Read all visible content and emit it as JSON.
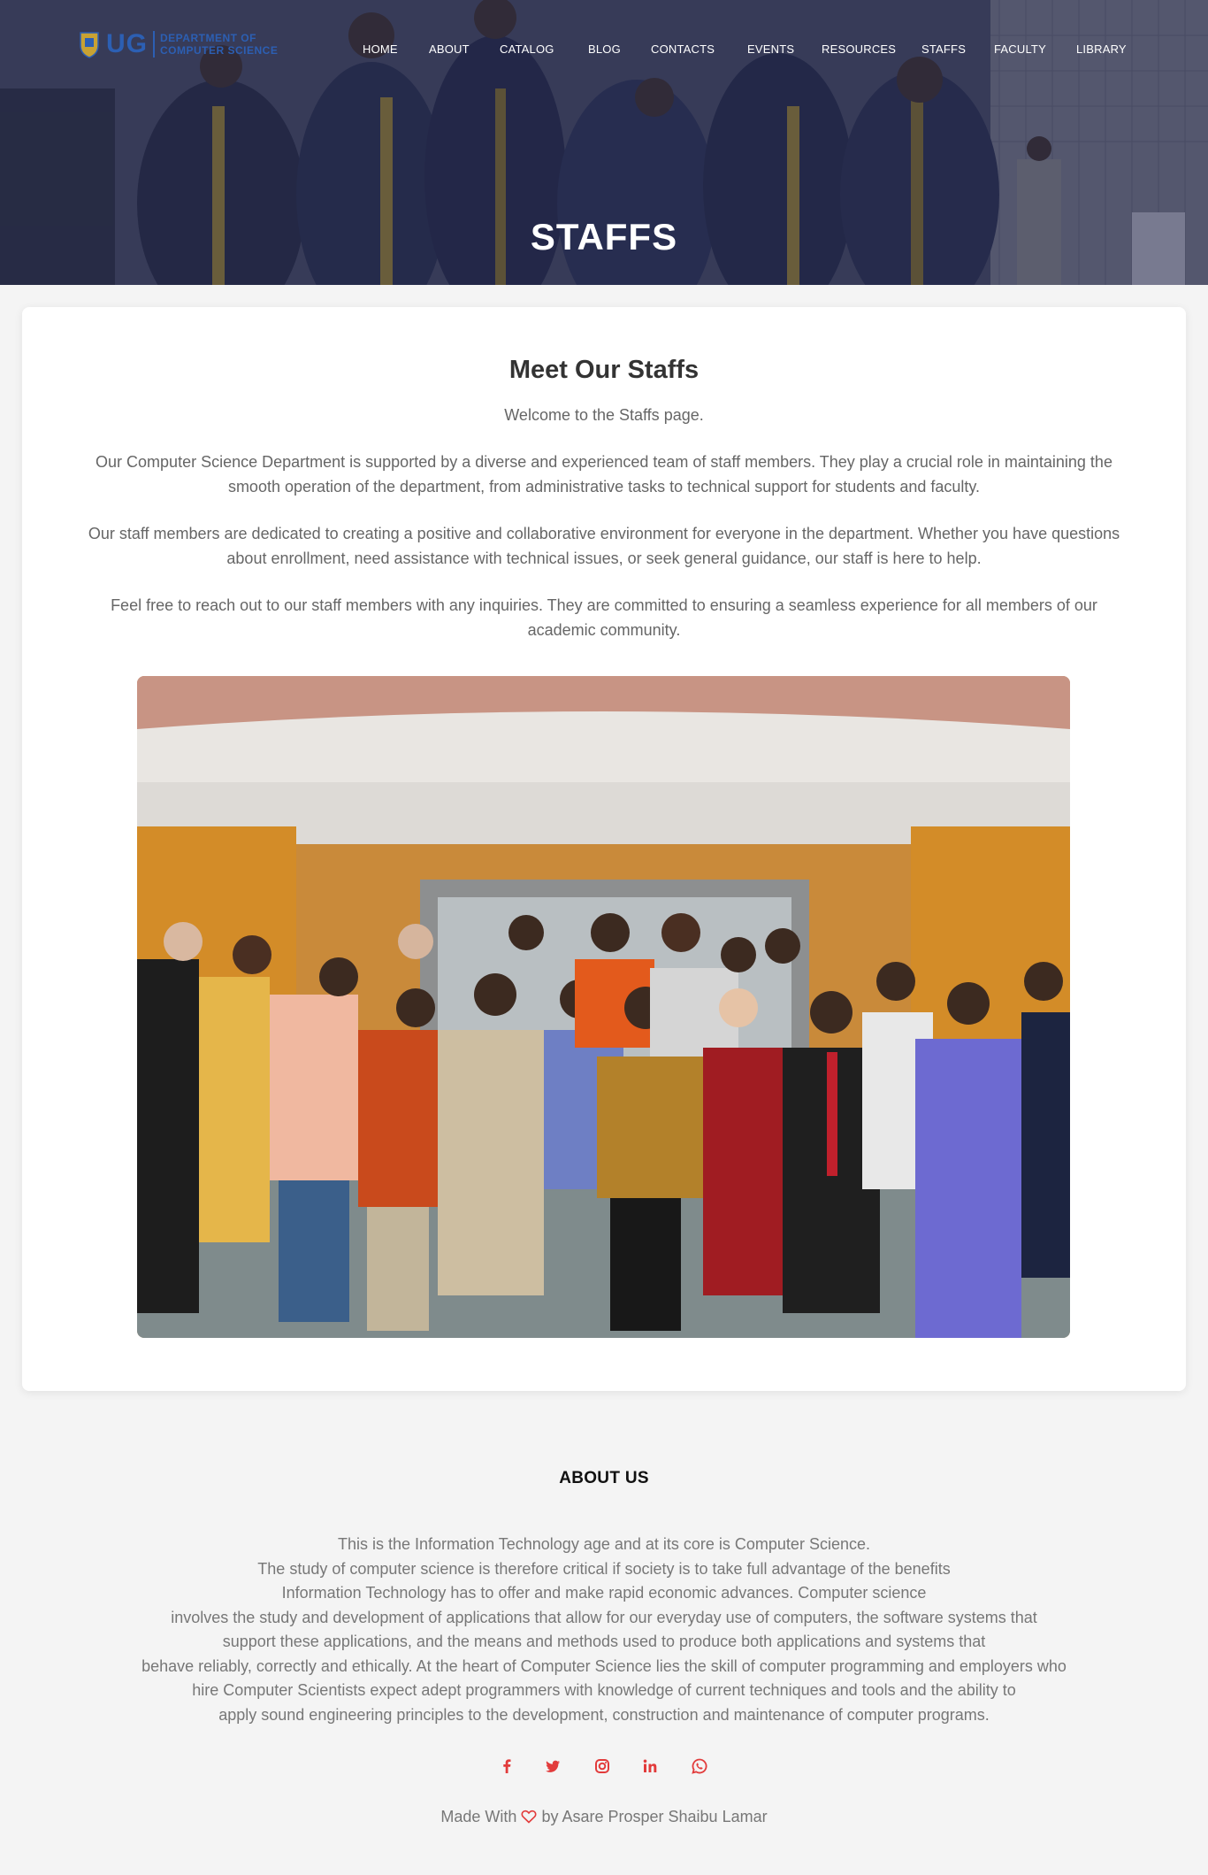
{
  "header": {
    "logo_uni": "UG",
    "logo_dept_line1": "DEPARTMENT OF",
    "logo_dept_line2": "COMPUTER SCIENCE",
    "nav": [
      "HOME",
      "ABOUT",
      "CATALOG",
      "BLOG",
      "CONTACTS",
      "EVENTS",
      "RESOURCES",
      "STAFFS",
      "FACULTY",
      "LIBRARY"
    ],
    "hero_title": "STAFFS"
  },
  "main": {
    "title": "Meet Our Staffs",
    "intro": "Welcome to the Staffs page.",
    "paragraphs": [
      "Our Computer Science Department is supported by a diverse and experienced team of staff members. They play a crucial role in maintaining the smooth operation of the department, from administrative tasks to technical support for students and faculty.",
      "Our staff members are dedicated to creating a positive and collaborative environment for everyone in the department. Whether you have questions about enrollment, need assistance with technical issues, or seek general guidance, our staff is here to help.",
      "Feel free to reach out to our staff members with any inquiries. They are committed to ensuring a seamless experience for all members of our academic community."
    ]
  },
  "footer": {
    "about_title": "ABOUT US",
    "about_lines": [
      "This is the Information Technology age and at its core is Computer Science.",
      "The study of computer science is therefore critical if society is to take full advantage of the benefits",
      "Information Technology has to offer and make rapid economic advances. Computer science",
      "involves the study and development of applications that allow for our everyday use of computers, the software systems that",
      "support these applications, and the means and methods used to produce both applications and systems that",
      "behave reliably, correctly and ethically. At the heart of Computer Science lies the skill of computer programming and employers who",
      "hire Computer Scientists expect adept programmers with knowledge of current techniques and tools and the ability to",
      "apply sound engineering principles to the development, construction and maintenance of computer programs."
    ],
    "socials": [
      "facebook-icon",
      "twitter-icon",
      "instagram-icon",
      "linkedin-icon",
      "whatsapp-icon"
    ],
    "credit_prefix": "Made With",
    "credit_suffix": "by Asare Prosper Shaibu Lamar",
    "accent": "#e23b3b"
  }
}
